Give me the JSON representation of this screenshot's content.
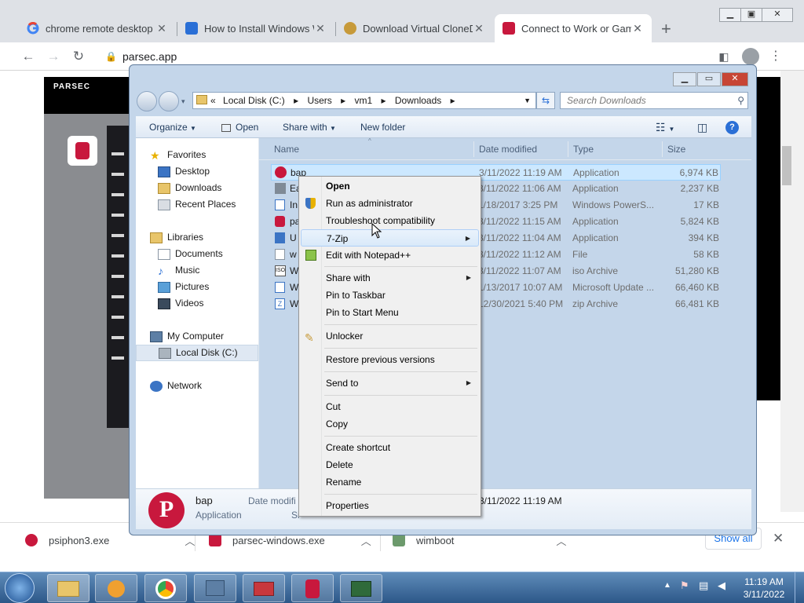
{
  "browser": {
    "tabs": [
      {
        "title": "chrome remote desktop -",
        "favicon": "google-g-icon"
      },
      {
        "title": "How to Install Windows W",
        "favicon": "windows-icon"
      },
      {
        "title": "Download Virtual CloneDr",
        "favicon": "clonedrive-icon"
      },
      {
        "title": "Connect to Work or Game",
        "favicon": "parsec-icon",
        "active": true
      }
    ],
    "url": "parsec.app",
    "remote_brand": "PARSEC",
    "downloads": [
      {
        "name": "psiphon3.exe",
        "icon": "psiphon-icon"
      },
      {
        "name": "parsec-windows.exe",
        "icon": "parsec-icon"
      },
      {
        "name": "wimboot",
        "icon": "archive-icon"
      }
    ],
    "show_all": "Show all"
  },
  "explorer": {
    "breadcrumb": [
      "«",
      "Local Disk (C:)",
      "Users",
      "vm1",
      "Downloads"
    ],
    "search_placeholder": "Search Downloads",
    "commands": {
      "organize": "Organize",
      "open": "Open",
      "share": "Share with",
      "new_folder": "New folder"
    },
    "nav": {
      "favorites": "Favorites",
      "desktop": "Desktop",
      "downloads": "Downloads",
      "recent": "Recent Places",
      "libraries": "Libraries",
      "documents": "Documents",
      "music": "Music",
      "pictures": "Pictures",
      "videos": "Videos",
      "computer": "My Computer",
      "localdisk": "Local Disk (C:)",
      "network": "Network"
    },
    "columns": {
      "name": "Name",
      "date": "Date modified",
      "type": "Type",
      "size": "Size"
    },
    "files": [
      {
        "name": "bap",
        "date": "3/11/2022 11:19 AM",
        "type": "Application",
        "size": "6,974 KB"
      },
      {
        "name": "Ea",
        "date": "3/11/2022 11:06 AM",
        "type": "Application",
        "size": "2,237 KB"
      },
      {
        "name": "In",
        "date": "1/18/2017 3:25 PM",
        "type": "Windows PowerS...",
        "size": "17 KB"
      },
      {
        "name": "pa",
        "date": "3/11/2022 11:15 AM",
        "type": "Application",
        "size": "5,824 KB"
      },
      {
        "name": "U",
        "date": "3/11/2022 11:04 AM",
        "type": "Application",
        "size": "394 KB"
      },
      {
        "name": "w",
        "date": "3/11/2022 11:12 AM",
        "type": "File",
        "size": "58 KB"
      },
      {
        "name": "W",
        "date": "3/11/2022 11:07 AM",
        "type": "iso Archive",
        "size": "51,280 KB"
      },
      {
        "name": "W",
        "date": "1/13/2017 10:07 AM",
        "type": "Microsoft Update ...",
        "size": "66,460 KB"
      },
      {
        "name": "W",
        "date": "12/30/2021 5:40 PM",
        "type": "zip Archive",
        "size": "66,481 KB"
      }
    ],
    "details": {
      "name": "bap",
      "type": "Application",
      "date_label": "Date modifi",
      "date": "3/11/2022 11:19 AM",
      "size_label": "Si"
    }
  },
  "context_menu": {
    "open": "Open",
    "run_admin": "Run as administrator",
    "troubleshoot": "Troubleshoot compatibility",
    "sevenzip": "7-Zip",
    "notepad": "Edit with Notepad++",
    "share": "Share with",
    "pin_taskbar": "Pin to Taskbar",
    "pin_start": "Pin to Start Menu",
    "unlocker": "Unlocker",
    "restore": "Restore previous versions",
    "send_to": "Send to",
    "cut": "Cut",
    "copy": "Copy",
    "create_shortcut": "Create shortcut",
    "delete": "Delete",
    "rename": "Rename",
    "properties": "Properties"
  },
  "taskbar": {
    "time": "11:19 AM",
    "date": "3/11/2022"
  },
  "colors": {
    "parsec": "#c8183d",
    "taskbar": "#2c5788",
    "selection": "#cce8ff"
  }
}
